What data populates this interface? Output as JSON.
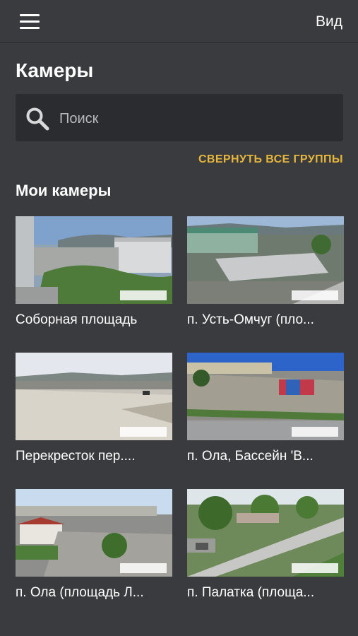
{
  "header": {
    "view_label": "Вид"
  },
  "page": {
    "title": "Камеры"
  },
  "search": {
    "placeholder": "Поиск"
  },
  "actions": {
    "collapse_all": "СВЕРНУТЬ ВСЕ ГРУППЫ"
  },
  "section": {
    "title": "Мои камеры"
  },
  "cameras": [
    {
      "name": "Соборная площадь"
    },
    {
      "name": "п. Усть-Омчуг (пло..."
    },
    {
      "name": "Перекресток пер...."
    },
    {
      "name": "п. Ола, Бассейн 'В..."
    },
    {
      "name": "п. Ола (площадь Л..."
    },
    {
      "name": "п. Палатка (площа..."
    }
  ],
  "colors": {
    "accent": "#e6b53c",
    "background": "#3a3b3f",
    "search_bg": "#2b2c2f"
  },
  "icons": {
    "menu": "hamburger-icon",
    "search": "search-icon"
  }
}
